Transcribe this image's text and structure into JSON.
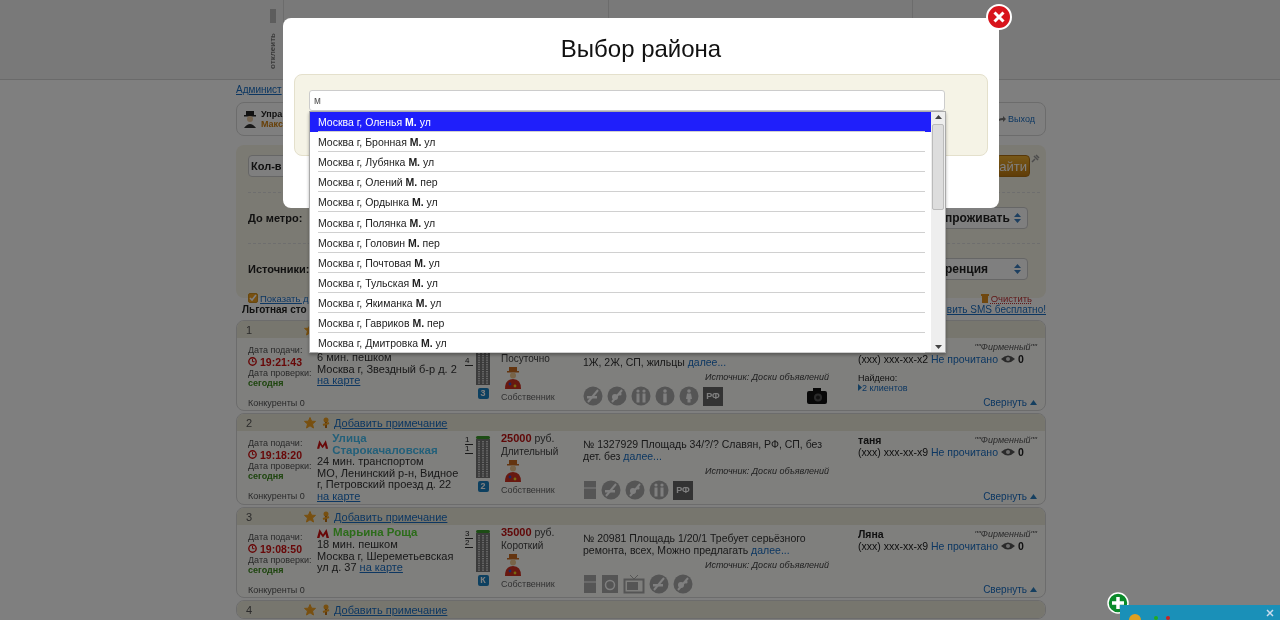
{
  "header": {
    "unpin_label": "отклеить"
  },
  "admin_link": "Админист",
  "user_panel": {
    "role": "Упра",
    "name": "Макс",
    "logout": "Выход"
  },
  "filters": {
    "count_select": "Кол-в",
    "find_button": "айти",
    "metro_label": "До метро:",
    "metro_select": "проживать",
    "sources_label": "Источники:",
    "sources_select": "ренция",
    "show_checkbox": {
      "label": "Показать д",
      "checked": true
    },
    "clear": "Очистить"
  },
  "section": {
    "title": "Льготная сто",
    "sms_link": "вить SMS бесплатно!"
  },
  "listings": [
    {
      "number": "1",
      "starred": true,
      "details": {
        "submitted_label": "Дата подачи:",
        "submitted_time": "19:21:43",
        "checked_label": "Дата проверки:",
        "checked_value": "сегодня",
        "competitors": "Конкуренты 0",
        "travel": "6 мин. пешком",
        "address": "Москва г, Звездный б-р д. 2",
        "map_link": "на карте",
        "building": {
          "floor": "4",
          "badge": "3"
        },
        "term": "Посуточно",
        "owner": "Собственник",
        "description": "1Ж, 2Ж, СП, жильцы",
        "more": "далее...",
        "source": "Источник: Доски объявлений",
        "amenities": [
          {
            "kind": "no-smoking"
          },
          {
            "kind": "no-pets"
          },
          {
            "kind": "couple"
          },
          {
            "kind": "man"
          },
          {
            "kind": "woman"
          },
          {
            "kind": "label",
            "text": "РФ"
          },
          {
            "kind": "photo"
          }
        ],
        "tag": "\"\"Фирменный\"\"",
        "phone": "(xxx) xxx-xx-x2",
        "read_status": "Не прочитано",
        "views": "0",
        "found_label": "Найдено:",
        "found_link": "2 клиентов",
        "collapse": "Свернуть"
      }
    },
    {
      "number": "2",
      "starred": true,
      "note_link": "Добавить примечание",
      "details": {
        "submitted_label": "Дата подачи:",
        "submitted_time": "19:18:20",
        "checked_label": "Дата проверки:",
        "checked_value": "сегодня",
        "competitors": "Конкуренты 0",
        "metro": {
          "name": "Улица Старокачаловская",
          "color": "#23607a"
        },
        "travel": "24 мин. транспортом",
        "address": "МО, Ленинский р-н, Видное г, Петровский проезд д. 22",
        "map_link": "на карте",
        "building": {
          "total": "1",
          "floor": "1",
          "badge": "2"
        },
        "price": "25000",
        "currency": "руб.",
        "term": "Длительный",
        "owner": "Собственник",
        "description": "№ 1327929 Площадь 34/?/? Славян, РФ, СП, без дет. без",
        "more": "далее...",
        "source": "Источник: Доски объявлений",
        "amenities": [
          {
            "kind": "fridge"
          },
          {
            "kind": "no-smoking"
          },
          {
            "kind": "no-pets"
          },
          {
            "kind": "couple"
          },
          {
            "kind": "label",
            "text": "РФ"
          }
        ],
        "tag": "\"\"Фирменный\"\"",
        "name": "таня",
        "phone": "(xxx) xxx-xx-x9",
        "read_status": "Не прочитано",
        "views": "0",
        "collapse": "Свернуть"
      }
    },
    {
      "number": "3",
      "starred": true,
      "note_link": "Добавить примечание",
      "details": {
        "submitted_label": "Дата подачи:",
        "submitted_time": "19:08:50",
        "checked_label": "Дата проверки:",
        "checked_value": "сегодня",
        "competitors": "Конкуренты 0",
        "metro": {
          "name": "Марьина Роща",
          "color": "#2c6c1a"
        },
        "travel": "18 мин. пешком",
        "address": "Москва г, Шереметьевская ул д. 37",
        "map_link": "на карте",
        "building": {
          "total": "3",
          "floor": "2",
          "badge": "К"
        },
        "price": "35000",
        "currency": "руб.",
        "term": "Короткий",
        "owner": "Собственник",
        "description": "№ 20981 Площадь 1/20/1 Требует серьёзного ремонта, всех, Можно предлагать",
        "more": "далее...",
        "source": "Источник: Доски объявлений",
        "amenities": [
          {
            "kind": "fridge"
          },
          {
            "kind": "washer"
          },
          {
            "kind": "tv"
          },
          {
            "kind": "no-smoking"
          },
          {
            "kind": "no-pets"
          }
        ],
        "tag": "\"\"Фирменный\"\"",
        "name": "Ляна",
        "phone": "(xxx) xxx-xx-x9",
        "read_status": "Не прочитано",
        "views": "0",
        "collapse": "Свернуть"
      }
    },
    {
      "number": "4",
      "starred": true,
      "note_link": "Добавить примечание"
    }
  ],
  "modal": {
    "title": "Выбор района",
    "search": {
      "value": "м"
    },
    "suggestions": [
      {
        "text": "Москва г, Оленья **М.** ул",
        "selected": true
      },
      {
        "text": "Москва г, Бронная **М.** ул",
        "selected": false
      },
      {
        "text": "Москва г, Лубянка **М.** ул",
        "selected": false
      },
      {
        "text": "Москва г, Олений **М.** пер",
        "selected": false
      },
      {
        "text": "Москва г, Ордынка **М.** ул",
        "selected": false
      },
      {
        "text": "Москва г, Полянка **М.** ул",
        "selected": false
      },
      {
        "text": "Москва г, Головин **М.** пер",
        "selected": false
      },
      {
        "text": "Москва г, Почтовая **М.** ул",
        "selected": false
      },
      {
        "text": "Москва г, Тульская **М.** ул",
        "selected": false
      },
      {
        "text": "Москва г, Якиманка **М.** ул",
        "selected": false
      },
      {
        "text": "Москва г, Гавриков **М.** пер",
        "selected": false
      },
      {
        "text": "Москва г, Дмитровка **М.** ул",
        "selected": false
      }
    ]
  }
}
